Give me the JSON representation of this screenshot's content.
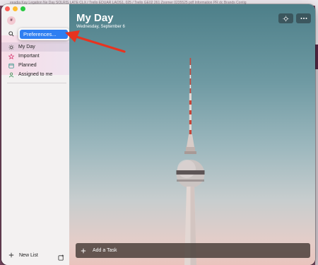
{
  "desktop": {
    "background_text": "eeadia  Kay Legation   Ne Day   SOLRIS LATE CLX / Trello   EDUAR LAOS1, 025 / Trello   GE02   261 Zoomer   0235525 pdf   Information   PR dc Brands   Contig"
  },
  "sidebar": {
    "avatar_initial": "#",
    "popup_item": "Preferences...",
    "items": [
      {
        "label": "My Day",
        "icon": "sun-icon",
        "active": true
      },
      {
        "label": "Important",
        "icon": "star-icon",
        "active": false
      },
      {
        "label": "Planned",
        "icon": "calendar-icon",
        "active": false
      },
      {
        "label": "Assigned to me",
        "icon": "person-icon",
        "active": false
      }
    ],
    "new_list_label": "New List"
  },
  "main": {
    "title": "My Day",
    "date": "Wednesday, September 6",
    "add_task_label": "Add a Task"
  },
  "colors": {
    "accent": "#2f7ff2",
    "annotation_arrow": "#e8331f"
  }
}
